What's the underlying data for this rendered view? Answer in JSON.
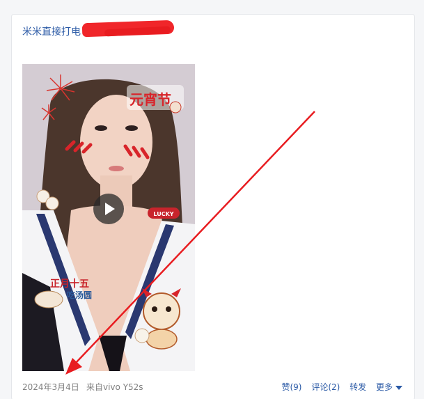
{
  "post": {
    "title": "米米直接打电",
    "date": "2024年3月4日",
    "source": "来自vivo Y52s"
  },
  "sticker": {
    "festival": "元宵节",
    "lucky": "LUCKY",
    "line1": "正月十五",
    "line2": "吃汤圆"
  },
  "actions": {
    "like": "赞(9)",
    "comment": "评论(2)",
    "share": "转发",
    "more": "更多"
  },
  "colors": {
    "link": "#2b5aa6",
    "annotation": "#e81c20"
  }
}
